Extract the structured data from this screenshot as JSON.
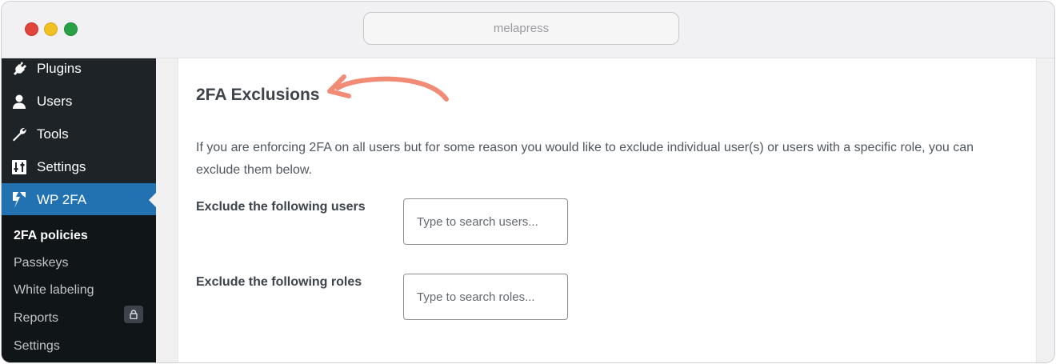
{
  "browser": {
    "url": "melapress"
  },
  "sidebar": {
    "menu": [
      {
        "label": "Plugins",
        "icon": "plugin-icon"
      },
      {
        "label": "Users",
        "icon": "users-icon"
      },
      {
        "label": "Tools",
        "icon": "wrench-icon"
      },
      {
        "label": "Settings",
        "icon": "settings-sliders-icon"
      },
      {
        "label": "WP 2FA",
        "icon": "wp2fa-logo-icon",
        "active": true
      }
    ],
    "submenu": [
      {
        "label": "2FA policies",
        "current": true
      },
      {
        "label": "Passkeys"
      },
      {
        "label": "White labeling"
      },
      {
        "label": "Reports",
        "badge_icon": "lock-icon"
      },
      {
        "label": "Settings"
      }
    ]
  },
  "main": {
    "heading": "2FA Exclusions",
    "description": "If you are enforcing 2FA on all users but for some reason you would like to exclude individual user(s) or users with a specific role, you can exclude them below.",
    "exclude_users": {
      "label": "Exclude the following users",
      "placeholder": "Type to search users..."
    },
    "exclude_roles": {
      "label": "Exclude the following roles",
      "placeholder": "Type to search roles..."
    }
  },
  "colors": {
    "sidebar_bg": "#1d2327",
    "submenu_bg": "#101517",
    "active_menu": "#2271b1",
    "annotation_arrow": "#f28b76"
  }
}
